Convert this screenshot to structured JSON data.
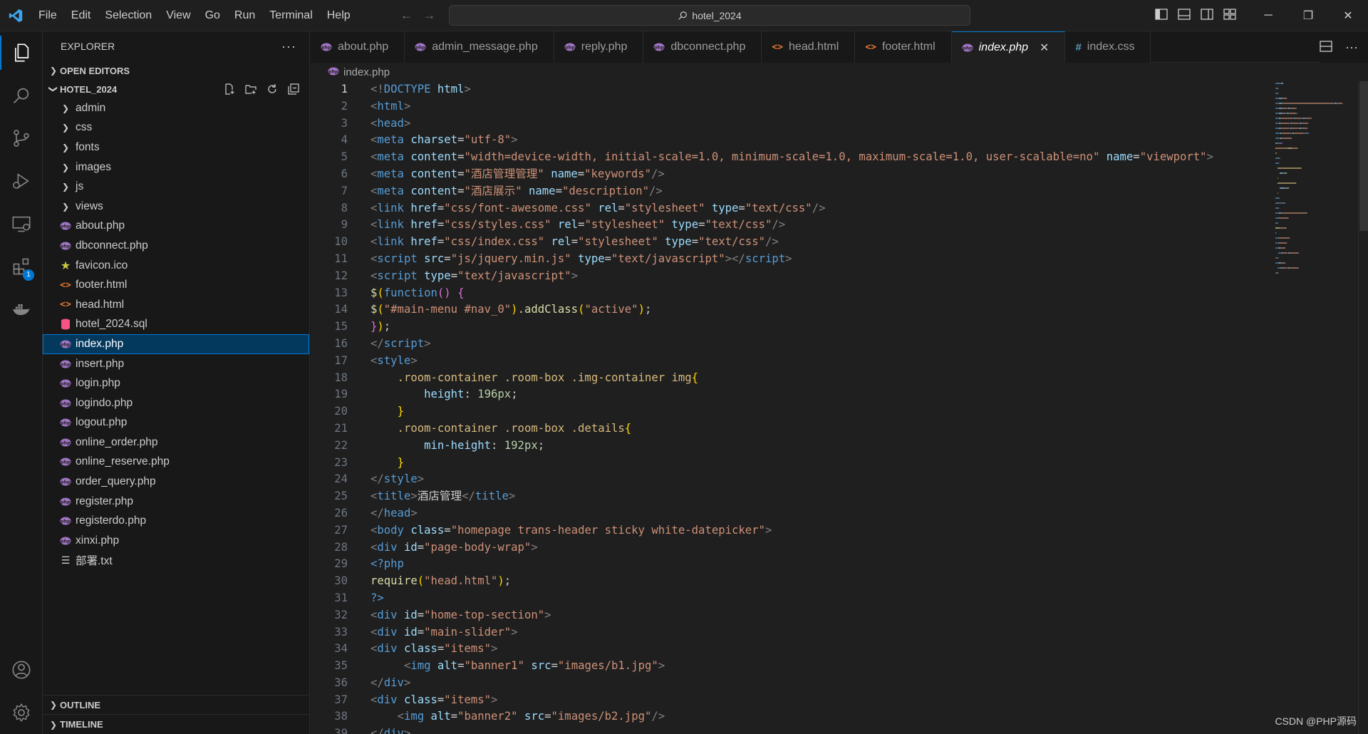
{
  "titlebar": {
    "menu": [
      "File",
      "Edit",
      "Selection",
      "View",
      "Go",
      "Run",
      "Terminal",
      "Help"
    ],
    "search_text": "hotel_2024",
    "icons": {
      "logo": "vscode-logo-icon",
      "back": "arrow-left-icon",
      "forward": "arrow-right-icon"
    }
  },
  "activity_bar": {
    "items": [
      "explorer-icon",
      "search-icon",
      "source-control-icon",
      "run-debug-icon",
      "remote-explorer-icon",
      "extensions-icon",
      "docker-icon"
    ],
    "extensions_badge": "1",
    "bottom": [
      "account-icon",
      "settings-gear-icon"
    ]
  },
  "sidebar": {
    "title": "EXPLORER",
    "more": "···",
    "open_editors": "OPEN EDITORS",
    "project": "HOTEL_2024",
    "tree": [
      {
        "name": "admin",
        "type": "folder"
      },
      {
        "name": "css",
        "type": "folder"
      },
      {
        "name": "fonts",
        "type": "folder"
      },
      {
        "name": "images",
        "type": "folder"
      },
      {
        "name": "js",
        "type": "folder"
      },
      {
        "name": "views",
        "type": "folder"
      },
      {
        "name": "about.php",
        "type": "php"
      },
      {
        "name": "dbconnect.php",
        "type": "php"
      },
      {
        "name": "favicon.ico",
        "type": "ico"
      },
      {
        "name": "footer.html",
        "type": "html"
      },
      {
        "name": "head.html",
        "type": "html"
      },
      {
        "name": "hotel_2024.sql",
        "type": "sql"
      },
      {
        "name": "index.php",
        "type": "php",
        "selected": true
      },
      {
        "name": "insert.php",
        "type": "php"
      },
      {
        "name": "login.php",
        "type": "php"
      },
      {
        "name": "logindo.php",
        "type": "php"
      },
      {
        "name": "logout.php",
        "type": "php"
      },
      {
        "name": "online_order.php",
        "type": "php"
      },
      {
        "name": "online_reserve.php",
        "type": "php"
      },
      {
        "name": "order_query.php",
        "type": "php"
      },
      {
        "name": "register.php",
        "type": "php"
      },
      {
        "name": "registerdo.php",
        "type": "php"
      },
      {
        "name": "xinxi.php",
        "type": "php"
      },
      {
        "name": "部署.txt",
        "type": "txt"
      }
    ],
    "outline": "OUTLINE",
    "timeline": "TIMELINE"
  },
  "tabs": [
    {
      "label": "about.php",
      "type": "php"
    },
    {
      "label": "admin_message.php",
      "type": "php"
    },
    {
      "label": "reply.php",
      "type": "php"
    },
    {
      "label": "dbconnect.php",
      "type": "php"
    },
    {
      "label": "head.html",
      "type": "html"
    },
    {
      "label": "footer.html",
      "type": "html"
    },
    {
      "label": "index.php",
      "type": "php",
      "active": true
    },
    {
      "label": "index.css",
      "type": "css"
    }
  ],
  "breadcrumb": "index.php",
  "code_lines": [
    [
      [
        "t-tag",
        "<!"
      ],
      [
        "t-name",
        "DOCTYPE"
      ],
      [
        "t-plain",
        " "
      ],
      [
        "t-attr",
        "html"
      ],
      [
        "t-tag",
        ">"
      ]
    ],
    [
      [
        "t-tag",
        "<"
      ],
      [
        "t-name",
        "html"
      ],
      [
        "t-tag",
        ">"
      ]
    ],
    [
      [
        "t-tag",
        "<"
      ],
      [
        "t-name",
        "head"
      ],
      [
        "t-tag",
        ">"
      ]
    ],
    [
      [
        "t-tag",
        "<"
      ],
      [
        "t-name",
        "meta"
      ],
      [
        "t-plain",
        " "
      ],
      [
        "t-attr",
        "charset"
      ],
      [
        "t-plain",
        "="
      ],
      [
        "t-str",
        "\"utf-8\""
      ],
      [
        "t-tag",
        ">"
      ]
    ],
    [
      [
        "t-tag",
        "<"
      ],
      [
        "t-name",
        "meta"
      ],
      [
        "t-plain",
        " "
      ],
      [
        "t-attr",
        "content"
      ],
      [
        "t-plain",
        "="
      ],
      [
        "t-str",
        "\"width=device-width, initial-scale=1.0, minimum-scale=1.0, maximum-scale=1.0, user-scalable=no\""
      ],
      [
        "t-plain",
        " "
      ],
      [
        "t-attr",
        "name"
      ],
      [
        "t-plain",
        "="
      ],
      [
        "t-str",
        "\"viewport\""
      ],
      [
        "t-tag",
        ">"
      ]
    ],
    [
      [
        "t-tag",
        "<"
      ],
      [
        "t-name",
        "meta"
      ],
      [
        "t-plain",
        " "
      ],
      [
        "t-attr",
        "content"
      ],
      [
        "t-plain",
        "="
      ],
      [
        "t-str",
        "\"酒店管理管理\""
      ],
      [
        "t-plain",
        " "
      ],
      [
        "t-attr",
        "name"
      ],
      [
        "t-plain",
        "="
      ],
      [
        "t-str",
        "\"keywords\""
      ],
      [
        "t-tag",
        "/>"
      ]
    ],
    [
      [
        "t-tag",
        "<"
      ],
      [
        "t-name",
        "meta"
      ],
      [
        "t-plain",
        " "
      ],
      [
        "t-attr",
        "content"
      ],
      [
        "t-plain",
        "="
      ],
      [
        "t-str",
        "\"酒店展示\""
      ],
      [
        "t-plain",
        " "
      ],
      [
        "t-attr",
        "name"
      ],
      [
        "t-plain",
        "="
      ],
      [
        "t-str",
        "\"description\""
      ],
      [
        "t-tag",
        "/>"
      ]
    ],
    [
      [
        "t-tag",
        "<"
      ],
      [
        "t-name",
        "link"
      ],
      [
        "t-plain",
        " "
      ],
      [
        "t-attr",
        "href"
      ],
      [
        "t-plain",
        "="
      ],
      [
        "t-str",
        "\"css/font-awesome.css\""
      ],
      [
        "t-plain",
        " "
      ],
      [
        "t-attr",
        "rel"
      ],
      [
        "t-plain",
        "="
      ],
      [
        "t-str",
        "\"stylesheet\""
      ],
      [
        "t-plain",
        " "
      ],
      [
        "t-attr",
        "type"
      ],
      [
        "t-plain",
        "="
      ],
      [
        "t-str",
        "\"text/css\""
      ],
      [
        "t-tag",
        "/>"
      ]
    ],
    [
      [
        "t-tag",
        "<"
      ],
      [
        "t-name",
        "link"
      ],
      [
        "t-plain",
        " "
      ],
      [
        "t-attr",
        "href"
      ],
      [
        "t-plain",
        "="
      ],
      [
        "t-str",
        "\"css/styles.css\""
      ],
      [
        "t-plain",
        " "
      ],
      [
        "t-attr",
        "rel"
      ],
      [
        "t-plain",
        "="
      ],
      [
        "t-str",
        "\"stylesheet\""
      ],
      [
        "t-plain",
        " "
      ],
      [
        "t-attr",
        "type"
      ],
      [
        "t-plain",
        "="
      ],
      [
        "t-str",
        "\"text/css\""
      ],
      [
        "t-tag",
        "/>"
      ]
    ],
    [
      [
        "t-tag",
        "<"
      ],
      [
        "t-name",
        "link"
      ],
      [
        "t-plain",
        " "
      ],
      [
        "t-attr",
        "href"
      ],
      [
        "t-plain",
        "="
      ],
      [
        "t-str",
        "\"css/index.css\""
      ],
      [
        "t-plain",
        " "
      ],
      [
        "t-attr",
        "rel"
      ],
      [
        "t-plain",
        "="
      ],
      [
        "t-str",
        "\"stylesheet\""
      ],
      [
        "t-plain",
        " "
      ],
      [
        "t-attr",
        "type"
      ],
      [
        "t-plain",
        "="
      ],
      [
        "t-str",
        "\"text/css\""
      ],
      [
        "t-tag",
        "/>"
      ]
    ],
    [
      [
        "t-tag",
        "<"
      ],
      [
        "t-name",
        "script"
      ],
      [
        "t-plain",
        " "
      ],
      [
        "t-attr",
        "src"
      ],
      [
        "t-plain",
        "="
      ],
      [
        "t-str",
        "\"js/jquery.min.js\""
      ],
      [
        "t-plain",
        " "
      ],
      [
        "t-attr",
        "type"
      ],
      [
        "t-plain",
        "="
      ],
      [
        "t-str",
        "\"text/javascript\""
      ],
      [
        "t-tag",
        "></"
      ],
      [
        "t-name",
        "script"
      ],
      [
        "t-tag",
        ">"
      ]
    ],
    [
      [
        "t-tag",
        "<"
      ],
      [
        "t-name",
        "script"
      ],
      [
        "t-plain",
        " "
      ],
      [
        "t-attr",
        "type"
      ],
      [
        "t-plain",
        "="
      ],
      [
        "t-str",
        "\"text/javascript\""
      ],
      [
        "t-tag",
        ">"
      ]
    ],
    [
      [
        "t-func",
        "$"
      ],
      [
        "t-brace",
        "("
      ],
      [
        "t-kw",
        "function"
      ],
      [
        "t-paren",
        "()"
      ],
      [
        "t-plain",
        " "
      ],
      [
        "t-paren",
        "{"
      ]
    ],
    [
      [
        "t-func",
        "$"
      ],
      [
        "t-brace",
        "("
      ],
      [
        "t-str",
        "\"#main-menu #nav_0\""
      ],
      [
        "t-brace",
        ")"
      ],
      [
        "t-plain",
        "."
      ],
      [
        "t-func",
        "addClass"
      ],
      [
        "t-brace",
        "("
      ],
      [
        "t-str",
        "\"active\""
      ],
      [
        "t-brace",
        ")"
      ],
      [
        "t-plain",
        ";"
      ]
    ],
    [
      [
        "t-paren",
        "}"
      ],
      [
        "t-brace",
        ")"
      ],
      [
        "t-plain",
        ";"
      ]
    ],
    [
      [
        "t-tag",
        "</"
      ],
      [
        "t-name",
        "script"
      ],
      [
        "t-tag",
        ">"
      ]
    ],
    [
      [
        "t-tag",
        "<"
      ],
      [
        "t-name",
        "style"
      ],
      [
        "t-tag",
        ">"
      ]
    ],
    [
      [
        "t-plain",
        "    "
      ],
      [
        "t-sel",
        ".room-container .room-box .img-container img"
      ],
      [
        "t-brace",
        "{"
      ]
    ],
    [
      [
        "t-plain",
        "        "
      ],
      [
        "t-attr",
        "height"
      ],
      [
        "t-plain",
        ": "
      ],
      [
        "t-num",
        "196px"
      ],
      [
        "t-plain",
        ";"
      ]
    ],
    [
      [
        "t-plain",
        "    "
      ],
      [
        "t-brace",
        "}"
      ]
    ],
    [
      [
        "t-plain",
        "    "
      ],
      [
        "t-sel",
        ".room-container .room-box .details"
      ],
      [
        "t-brace",
        "{"
      ]
    ],
    [
      [
        "t-plain",
        "        "
      ],
      [
        "t-attr",
        "min-height"
      ],
      [
        "t-plain",
        ": "
      ],
      [
        "t-num",
        "192px"
      ],
      [
        "t-plain",
        ";"
      ]
    ],
    [
      [
        "t-plain",
        "    "
      ],
      [
        "t-brace",
        "}"
      ]
    ],
    [
      [
        "t-tag",
        "</"
      ],
      [
        "t-name",
        "style"
      ],
      [
        "t-tag",
        ">"
      ]
    ],
    [
      [
        "t-tag",
        "<"
      ],
      [
        "t-name",
        "title"
      ],
      [
        "t-tag",
        ">"
      ],
      [
        "t-plain",
        "酒店管理"
      ],
      [
        "t-tag",
        "</"
      ],
      [
        "t-name",
        "title"
      ],
      [
        "t-tag",
        ">"
      ]
    ],
    [
      [
        "t-tag",
        "</"
      ],
      [
        "t-name",
        "head"
      ],
      [
        "t-tag",
        ">"
      ]
    ],
    [
      [
        "t-tag",
        "<"
      ],
      [
        "t-name",
        "body"
      ],
      [
        "t-plain",
        " "
      ],
      [
        "t-attr",
        "class"
      ],
      [
        "t-plain",
        "="
      ],
      [
        "t-str",
        "\"homepage trans-header sticky white-datepicker\""
      ],
      [
        "t-tag",
        ">"
      ]
    ],
    [
      [
        "t-tag",
        "<"
      ],
      [
        "t-name",
        "div"
      ],
      [
        "t-plain",
        " "
      ],
      [
        "t-attr",
        "id"
      ],
      [
        "t-plain",
        "="
      ],
      [
        "t-str",
        "\"page-body-wrap\""
      ],
      [
        "t-tag",
        ">"
      ]
    ],
    [
      [
        "t-php",
        "<?php"
      ]
    ],
    [
      [
        "t-func",
        "require"
      ],
      [
        "t-brace",
        "("
      ],
      [
        "t-str",
        "\"head.html\""
      ],
      [
        "t-brace",
        ")"
      ],
      [
        "t-plain",
        ";"
      ]
    ],
    [
      [
        "t-php",
        "?>"
      ]
    ],
    [
      [
        "t-tag",
        "<"
      ],
      [
        "t-name",
        "div"
      ],
      [
        "t-plain",
        " "
      ],
      [
        "t-attr",
        "id"
      ],
      [
        "t-plain",
        "="
      ],
      [
        "t-str",
        "\"home-top-section\""
      ],
      [
        "t-tag",
        ">"
      ]
    ],
    [
      [
        "t-tag",
        "<"
      ],
      [
        "t-name",
        "div"
      ],
      [
        "t-plain",
        " "
      ],
      [
        "t-attr",
        "id"
      ],
      [
        "t-plain",
        "="
      ],
      [
        "t-str",
        "\"main-slider\""
      ],
      [
        "t-tag",
        ">"
      ]
    ],
    [
      [
        "t-tag",
        "<"
      ],
      [
        "t-name",
        "div"
      ],
      [
        "t-plain",
        " "
      ],
      [
        "t-attr",
        "class"
      ],
      [
        "t-plain",
        "="
      ],
      [
        "t-str",
        "\"items\""
      ],
      [
        "t-tag",
        ">"
      ]
    ],
    [
      [
        "t-plain",
        "     "
      ],
      [
        "t-tag",
        "<"
      ],
      [
        "t-name",
        "img"
      ],
      [
        "t-plain",
        " "
      ],
      [
        "t-attr",
        "alt"
      ],
      [
        "t-plain",
        "="
      ],
      [
        "t-str",
        "\"banner1\""
      ],
      [
        "t-plain",
        " "
      ],
      [
        "t-attr",
        "src"
      ],
      [
        "t-plain",
        "="
      ],
      [
        "t-str",
        "\"images/b1.jpg\""
      ],
      [
        "t-tag",
        ">"
      ]
    ],
    [
      [
        "t-tag",
        "</"
      ],
      [
        "t-name",
        "div"
      ],
      [
        "t-tag",
        ">"
      ]
    ],
    [
      [
        "t-tag",
        "<"
      ],
      [
        "t-name",
        "div"
      ],
      [
        "t-plain",
        " "
      ],
      [
        "t-attr",
        "class"
      ],
      [
        "t-plain",
        "="
      ],
      [
        "t-str",
        "\"items\""
      ],
      [
        "t-tag",
        ">"
      ]
    ],
    [
      [
        "t-plain",
        "    "
      ],
      [
        "t-tag",
        "<"
      ],
      [
        "t-name",
        "img"
      ],
      [
        "t-plain",
        " "
      ],
      [
        "t-attr",
        "alt"
      ],
      [
        "t-plain",
        "="
      ],
      [
        "t-str",
        "\"banner2\""
      ],
      [
        "t-plain",
        " "
      ],
      [
        "t-attr",
        "src"
      ],
      [
        "t-plain",
        "="
      ],
      [
        "t-str",
        "\"images/b2.jpg\""
      ],
      [
        "t-tag",
        "/>"
      ]
    ],
    [
      [
        "t-tag",
        "</"
      ],
      [
        "t-name",
        "div"
      ],
      [
        "t-tag",
        ">"
      ]
    ]
  ],
  "current_line": 1,
  "watermark": "CSDN @PHP源码",
  "colors": {
    "accent": "#0078d4",
    "php_icon": "#a074c4",
    "html_icon": "#e37933",
    "css_icon": "#519aba",
    "sql_icon": "#f55385",
    "ico_icon": "#cbcb41"
  }
}
